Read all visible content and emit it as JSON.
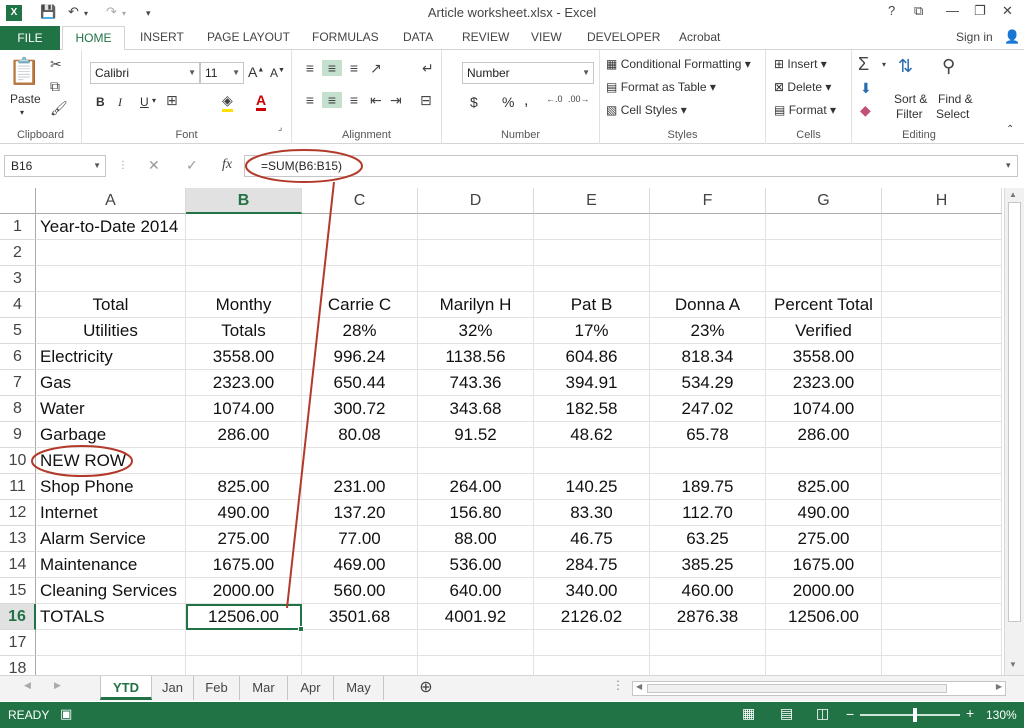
{
  "app": {
    "window_title": "Article worksheet.xlsx - Excel",
    "excel_icon": "X",
    "qat_icons": [
      "save-icon",
      "undo-icon",
      "redo-icon",
      "customize-qat-icon"
    ],
    "window_buttons": [
      "?",
      "⧉",
      "—",
      "❐",
      "✕"
    ],
    "sign_in": "Sign in"
  },
  "tabs": {
    "file": "FILE",
    "items": [
      "HOME",
      "INSERT",
      "PAGE LAYOUT",
      "FORMULAS",
      "DATA",
      "REVIEW",
      "VIEW",
      "DEVELOPER",
      "Acrobat"
    ],
    "active": "HOME"
  },
  "ribbon": {
    "clipboard": {
      "label": "Clipboard",
      "paste": "Paste"
    },
    "font": {
      "label": "Font",
      "name": "Calibri",
      "size": "11",
      "bold": "B",
      "italic": "I",
      "underline": "U"
    },
    "alignment": {
      "label": "Alignment"
    },
    "number": {
      "label": "Number",
      "format": "Number",
      "currency": "$",
      "percent": "%",
      "comma": ","
    },
    "styles": {
      "label": "Styles",
      "conditional": "Conditional Formatting",
      "format_table": "Format as Table",
      "cell_styles": "Cell Styles"
    },
    "cells": {
      "label": "Cells",
      "insert": "Insert",
      "delete": "Delete",
      "format": "Format"
    },
    "editing": {
      "label": "Editing",
      "sort_filter_1": "Sort &",
      "sort_filter_2": "Filter",
      "find_select_1": "Find &",
      "find_select_2": "Select"
    }
  },
  "formula_bar": {
    "name_box": "B16",
    "fx": "fx",
    "formula": "=SUM(B6:B15)"
  },
  "sheet": {
    "columns": [
      "A",
      "B",
      "C",
      "D",
      "E",
      "F",
      "G",
      "H"
    ],
    "active_column": "B",
    "active_row": "16",
    "rows": [
      {
        "n": "1",
        "cells": [
          "Year-to-Date 2014",
          "",
          "",
          "",
          "",
          "",
          "",
          ""
        ]
      },
      {
        "n": "2",
        "cells": [
          "",
          "",
          "",
          "",
          "",
          "",
          "",
          ""
        ]
      },
      {
        "n": "3",
        "cells": [
          "",
          "",
          "",
          "",
          "",
          "",
          "",
          ""
        ]
      },
      {
        "n": "4",
        "cells": [
          "Total",
          "Monthy",
          "Carrie C",
          "Marilyn H",
          "Pat B",
          "Donna A",
          "Percent Total",
          ""
        ]
      },
      {
        "n": "5",
        "cells": [
          "Utilities",
          "Totals",
          "28%",
          "32%",
          "17%",
          "23%",
          "Verified",
          ""
        ]
      },
      {
        "n": "6",
        "cells": [
          "Electricity",
          "3558.00",
          "996.24",
          "1138.56",
          "604.86",
          "818.34",
          "3558.00",
          ""
        ]
      },
      {
        "n": "7",
        "cells": [
          "Gas",
          "2323.00",
          "650.44",
          "743.36",
          "394.91",
          "534.29",
          "2323.00",
          ""
        ]
      },
      {
        "n": "8",
        "cells": [
          "Water",
          "1074.00",
          "300.72",
          "343.68",
          "182.58",
          "247.02",
          "1074.00",
          ""
        ]
      },
      {
        "n": "9",
        "cells": [
          "Garbage",
          "286.00",
          "80.08",
          "91.52",
          "48.62",
          "65.78",
          "286.00",
          ""
        ]
      },
      {
        "n": "10",
        "cells": [
          "NEW ROW",
          "",
          "",
          "",
          "",
          "",
          "",
          ""
        ]
      },
      {
        "n": "11",
        "cells": [
          "Shop Phone",
          "825.00",
          "231.00",
          "264.00",
          "140.25",
          "189.75",
          "825.00",
          ""
        ]
      },
      {
        "n": "12",
        "cells": [
          "Internet",
          "490.00",
          "137.20",
          "156.80",
          "83.30",
          "112.70",
          "490.00",
          ""
        ]
      },
      {
        "n": "13",
        "cells": [
          "Alarm Service",
          "275.00",
          "77.00",
          "88.00",
          "46.75",
          "63.25",
          "275.00",
          ""
        ]
      },
      {
        "n": "14",
        "cells": [
          "Maintenance",
          "1675.00",
          "469.00",
          "536.00",
          "284.75",
          "385.25",
          "1675.00",
          ""
        ]
      },
      {
        "n": "15",
        "cells": [
          "Cleaning Services",
          "2000.00",
          "560.00",
          "640.00",
          "340.00",
          "460.00",
          "2000.00",
          ""
        ]
      },
      {
        "n": "16",
        "cells": [
          "TOTALS",
          "12506.00",
          "3501.68",
          "4001.92",
          "2126.02",
          "2876.38",
          "12506.00",
          ""
        ]
      },
      {
        "n": "17",
        "cells": [
          "",
          "",
          "",
          "",
          "",
          "",
          "",
          ""
        ]
      },
      {
        "n": "18",
        "cells": [
          "",
          "",
          "",
          "",
          "",
          "",
          "",
          ""
        ]
      }
    ]
  },
  "sheet_tabs": {
    "items": [
      "YTD",
      "Jan",
      "Feb",
      "Mar",
      "Apr",
      "May"
    ],
    "active": "YTD",
    "add": "⊕"
  },
  "status": {
    "ready": "READY",
    "zoom": "130%",
    "zoom_level_percent": 130
  },
  "annotations": {
    "color": "#b33a2a"
  }
}
